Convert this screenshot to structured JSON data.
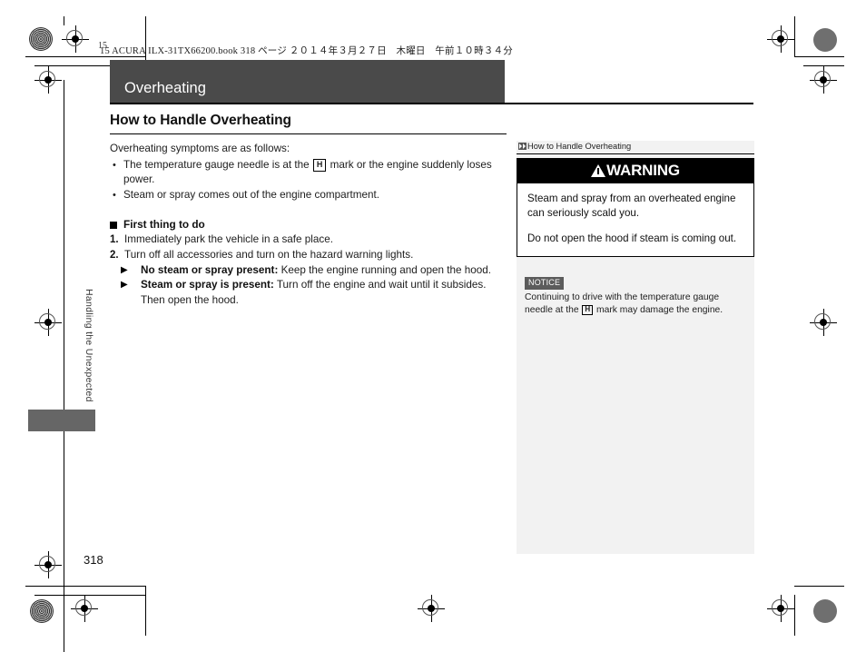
{
  "document": {
    "book_header": "15 ACURA  ILX-31TX66200.book  318 ページ  ２０１４年３月２７日　木曜日　午前１０時３４分",
    "chapter_title": "Overheating",
    "page_number": "318",
    "side_tab_label": "Handling the Unexpected",
    "corner_label": "15"
  },
  "main": {
    "heading": "How to Handle Overheating",
    "intro": "Overheating symptoms are as follows:",
    "symptoms": [
      {
        "before": "The temperature gauge needle is at the ",
        "mark": "H",
        "after": " mark or the engine suddenly loses power."
      },
      {
        "before": "Steam or spray comes out of the engine compartment.",
        "mark": "",
        "after": ""
      }
    ],
    "subheading": "First thing to do",
    "steps": [
      "Immediately park the vehicle in a safe place.",
      "Turn off all accessories and turn on the hazard warning lights."
    ],
    "sub_actions": [
      {
        "arrow": "▶",
        "lead": "No steam or spray present:",
        "text": " Keep the engine running and open the hood."
      },
      {
        "arrow": "▶",
        "lead": "Steam or spray is present:",
        "text": " Turn off the engine and wait until it subsides. Then open the hood."
      }
    ]
  },
  "sidebar": {
    "header_label": "How to Handle Overheating",
    "warning": {
      "title": "WARNING",
      "paragraphs": [
        "Steam and spray from an overheated engine can seriously scald you.",
        "Do not open the hood if steam is coming out."
      ]
    },
    "notice": {
      "tag": "NOTICE",
      "before": "Continuing to drive with the temperature gauge needle at the ",
      "mark": "H",
      "after": " mark may damage the engine."
    }
  },
  "colors": {
    "title_bar": "#4a4a4a",
    "sidebar_bg": "#f2f2f2",
    "warning_bar": "#000000",
    "notice_tag": "#5c5c5c",
    "side_tab": "#666666"
  }
}
